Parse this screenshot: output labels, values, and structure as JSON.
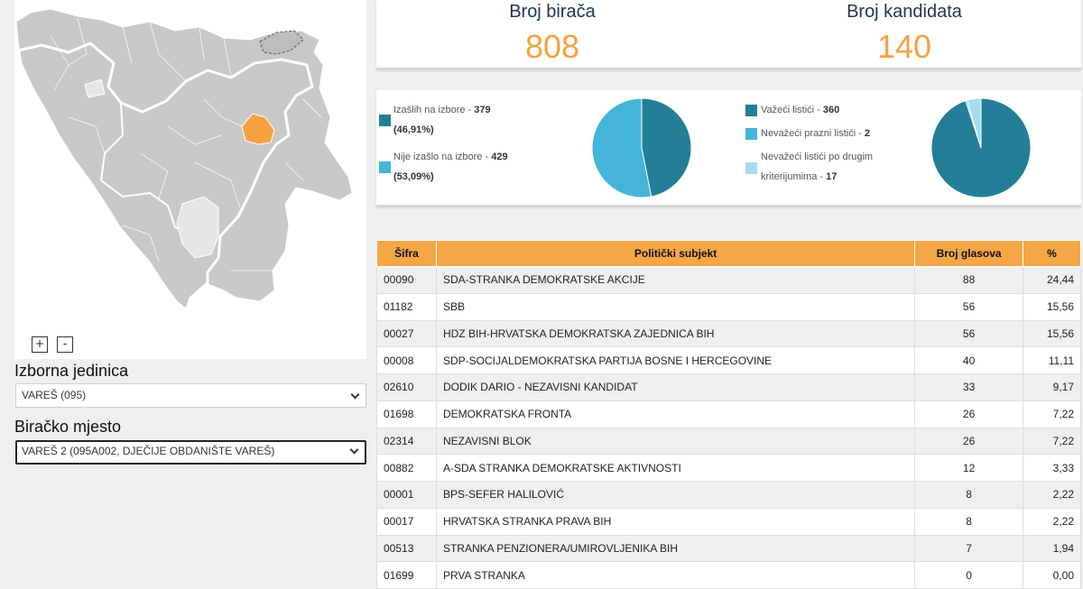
{
  "map": {
    "zoom_in": "+",
    "zoom_out": "-",
    "colors": {
      "land": "#c8c8c8",
      "border": "#ffffff",
      "selected": "#f4a340",
      "outside": "#ffffff"
    }
  },
  "unit": {
    "label": "Izborna jedinica",
    "selected": "VAREŠ (095)"
  },
  "station": {
    "label": "Biračko mjesto",
    "selected": "VAREŠ 2 (095A002, DJEČIJE OBDANIŠTE VAREŠ)"
  },
  "stats": {
    "voters_title": "Broj birača",
    "voters_value": "808",
    "candidates_title": "Broj kandidata",
    "candidates_value": "140"
  },
  "turnout": {
    "voted_label": "Izašlih na izbore - ",
    "voted_count": "379",
    "voted_pct": "(46,91%)",
    "not_voted_label": "Nije izašlo na izbore - ",
    "not_voted_count": "429",
    "not_voted_pct": "(53,09%)",
    "colors": {
      "voted": "#237f97",
      "not_voted": "#44b5d8"
    },
    "values": [
      379,
      429
    ]
  },
  "ballots": {
    "valid_label": "Važeći listići - ",
    "valid_count": "360",
    "blank_label": "Nevažeći prazni listići - ",
    "blank_count": "2",
    "other_label_1": "Nevažeći listići po drugim",
    "other_label_2": "kriterijumima - ",
    "other_count": "17",
    "colors": {
      "valid": "#237f97",
      "blank": "#44b5d8",
      "other": "#a6dcef"
    },
    "values": [
      360,
      2,
      17
    ]
  },
  "table": {
    "headers": {
      "code": "Šifra",
      "name": "Politički subjekt",
      "votes": "Broj glasova",
      "pct": "%"
    },
    "rows": [
      {
        "code": "00090",
        "name": "SDA-STRANKA DEMOKRATSKE AKCIJE",
        "votes": "88",
        "pct": "24,44"
      },
      {
        "code": "01182",
        "name": "SBB",
        "votes": "56",
        "pct": "15,56"
      },
      {
        "code": "00027",
        "name": "HDZ BIH-HRVATSKA DEMOKRATSKA ZAJEDNICA BIH",
        "votes": "56",
        "pct": "15,56"
      },
      {
        "code": "00008",
        "name": "SDP-SOCIJALDEMOKRATSKA PARTIJA BOSNE I HERCEGOVINE",
        "votes": "40",
        "pct": "11,11"
      },
      {
        "code": "02610",
        "name": "DODIK DARIO - NEZAVISNI KANDIDAT",
        "votes": "33",
        "pct": "9,17"
      },
      {
        "code": "01698",
        "name": "DEMOKRATSKA FRONTA",
        "votes": "26",
        "pct": "7,22"
      },
      {
        "code": "02314",
        "name": "NEZAVISNI BLOK",
        "votes": "26",
        "pct": "7,22"
      },
      {
        "code": "00882",
        "name": "A-SDA STRANKA DEMOKRATSKE AKTIVNOSTI",
        "votes": "12",
        "pct": "3,33"
      },
      {
        "code": "00001",
        "name": "BPS-SEFER HALILOVIĆ",
        "votes": "8",
        "pct": "2,22"
      },
      {
        "code": "00017",
        "name": "HRVATSKA STRANKA PRAVA BIH",
        "votes": "8",
        "pct": "2,22"
      },
      {
        "code": "00513",
        "name": "STRANKA PENZIONERA/UMIROVLJENIKA BIH",
        "votes": "7",
        "pct": "1,94"
      },
      {
        "code": "01699",
        "name": "PRVA STRANKA",
        "votes": "0",
        "pct": "0,00"
      }
    ]
  }
}
